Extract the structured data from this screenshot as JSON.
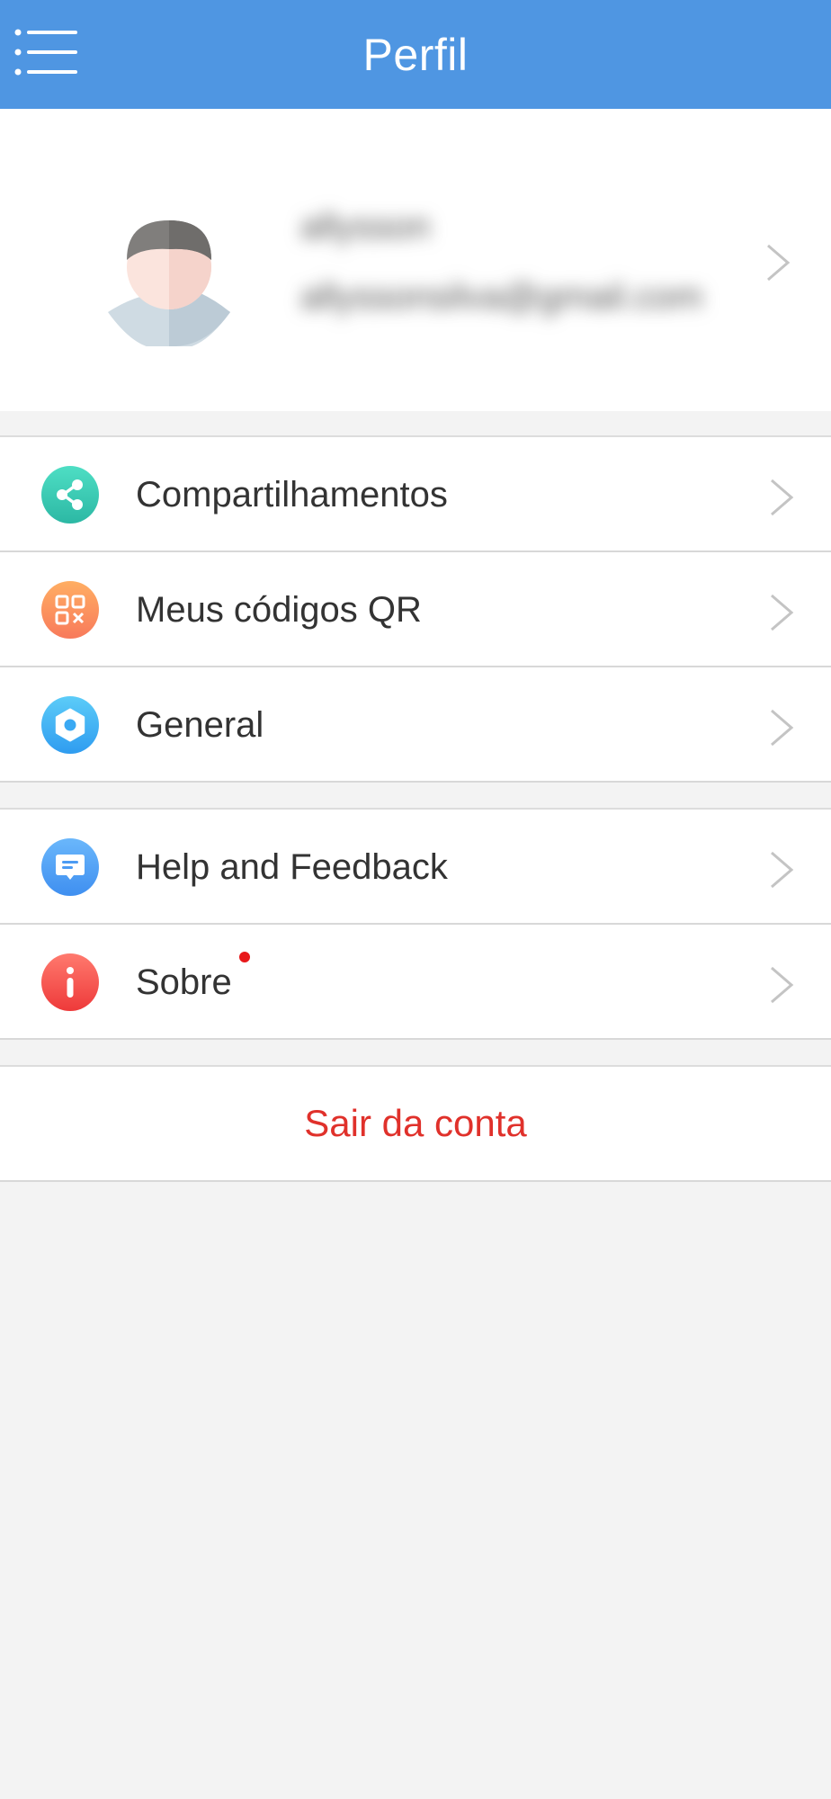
{
  "header": {
    "title": "Perfil",
    "menu_icon": "menu-icon"
  },
  "profile": {
    "name": "allysson",
    "email": "allyssonsilva@gmail.com",
    "avatar_icon": "user-avatar-icon",
    "blurred": true
  },
  "menu": {
    "group1": [
      {
        "label": "Compartilhamentos",
        "icon": "share-icon",
        "color_top": "#4edec4",
        "color_bottom": "#2cb8a4"
      },
      {
        "label": "Meus códigos QR",
        "icon": "qr-code-icon",
        "color_top": "#ffae63",
        "color_bottom": "#f87a5b"
      },
      {
        "label": "General",
        "icon": "gear-icon",
        "color_top": "#5cccf8",
        "color_bottom": "#2f9cf0"
      }
    ],
    "group2": [
      {
        "label": "Help and Feedback",
        "icon": "feedback-icon",
        "color_top": "#6ab7fb",
        "color_bottom": "#3f8ff0"
      },
      {
        "label": "Sobre",
        "icon": "info-icon",
        "color_top": "#ff7a6e",
        "color_bottom": "#ee3a3a",
        "has_notification": true
      }
    ]
  },
  "logout": {
    "label": "Sair da conta"
  },
  "colors": {
    "header_bg": "#4f96e2",
    "page_bg": "#f3f3f3",
    "logout_text": "#e0312b",
    "notification_dot": "#e8181a"
  }
}
